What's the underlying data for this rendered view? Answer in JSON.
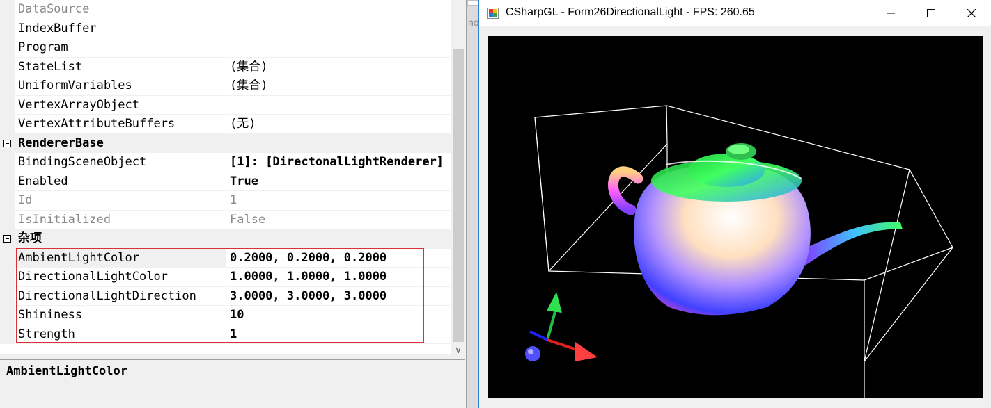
{
  "property_grid": {
    "rows": [
      {
        "name": "DataSource",
        "value": "",
        "disabled": true
      },
      {
        "name": "IndexBuffer",
        "value": ""
      },
      {
        "name": "Program",
        "value": ""
      },
      {
        "name": "StateList",
        "value": "(集合)"
      },
      {
        "name": "UniformVariables",
        "value": "(集合)"
      },
      {
        "name": "VertexArrayObject",
        "value": ""
      },
      {
        "name": "VertexAttributeBuffers",
        "value": "(无)"
      },
      {
        "category": "RendererBase"
      },
      {
        "name": "BindingSceneObject",
        "value": "[1]: [DirectonalLightRenderer]",
        "bold": true
      },
      {
        "name": "Enabled",
        "value": "True",
        "bold": true
      },
      {
        "name": "Id",
        "value": "1",
        "disabled": true
      },
      {
        "name": "IsInitialized",
        "value": "False",
        "disabled": true
      },
      {
        "category": "杂项"
      },
      {
        "name": "AmbientLightColor",
        "value": "0.2000, 0.2000, 0.2000",
        "bold": true,
        "selected": true
      },
      {
        "name": "DirectionalLightColor",
        "value": "1.0000, 1.0000, 1.0000",
        "bold": true
      },
      {
        "name": "DirectionalLightDirection",
        "value": "3.0000, 3.0000, 3.0000",
        "bold": true
      },
      {
        "name": "Shininess",
        "value": "10",
        "bold": true
      },
      {
        "name": "Strength",
        "value": "1",
        "bold": true
      }
    ],
    "scroll_down_glyph": "∨",
    "description_title": "AmbientLightColor"
  },
  "background_window": {
    "partial_text": "no"
  },
  "gl_window": {
    "title": "CSharpGL - Form26DirectionalLight - FPS: 260.65",
    "app_icon": "csharpgl-app-icon",
    "buttons": {
      "minimize": "minimize-icon",
      "maximize": "maximize-icon",
      "close": "close-icon"
    }
  },
  "colors": {
    "highlight_border": "#d9303a",
    "viewport_bg": "#000000",
    "window_accent": "#2d7fd0"
  }
}
